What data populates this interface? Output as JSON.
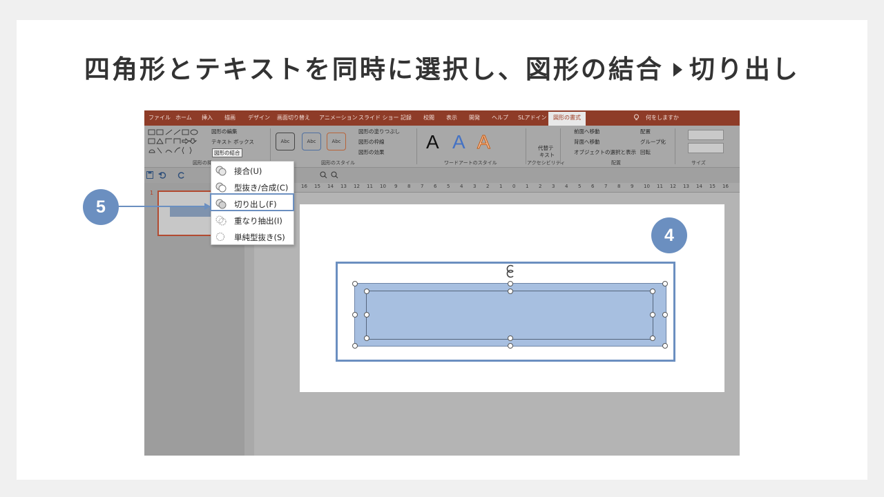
{
  "heading": {
    "before": "四角形とテキストを同時に選択し、図形の結合",
    "after": "切り出し"
  },
  "menubar": {
    "tabs": [
      "ファイル",
      "ホーム",
      "挿入",
      "描画",
      "デザイン",
      "画面切り替え",
      "アニメーション",
      "スライド ショー",
      "記録",
      "校閲",
      "表示",
      "開発",
      "ヘルプ",
      "SLアドイン"
    ],
    "active_tab": "図形の書式",
    "tell_me": "何をしますか"
  },
  "ribbon": {
    "edit_shape": "図形の編集",
    "text_box": "テキスト ボックス",
    "merge_shapes": "図形の結合",
    "insert_group_label": "図形の挿",
    "style_samples": [
      "Abc",
      "Abc",
      "Abc"
    ],
    "shape_fill": "図形の塗りつぶし",
    "shape_outline": "図形の枠線",
    "shape_effects": "図形の効果",
    "shape_styles_group": "図形のスタイル",
    "wordart_letter": "A",
    "wordart_group": "ワードアートのスタイル",
    "alt_text_line1": "代替テ",
    "alt_text_line2": "キスト",
    "accessibility_group": "アクセシビリティ",
    "bring_forward": "前面へ移動",
    "send_backward": "背面へ移動",
    "selection_pane": "オブジェクトの選択と表示",
    "align": "配置",
    "group": "グループ化",
    "rotate": "回転",
    "arrange_group": "配置",
    "size_group": "サイズ"
  },
  "ruler": {
    "marks": [
      "16",
      "15",
      "14",
      "13",
      "12",
      "11",
      "10",
      "9",
      "8",
      "7",
      "6",
      "5",
      "4",
      "3",
      "2",
      "1",
      "0",
      "1",
      "2",
      "3",
      "4",
      "5",
      "6",
      "7",
      "8",
      "9",
      "10",
      "11",
      "12",
      "13",
      "14",
      "15",
      "16"
    ]
  },
  "thumbnail": {
    "number": "1"
  },
  "merge_menu": {
    "items": [
      {
        "label": "接合(U)"
      },
      {
        "label": "型抜き/合成(C)"
      },
      {
        "label": "切り出し(F)"
      },
      {
        "label": "重なり抽出(I)"
      },
      {
        "label": "単純型抜き(S)"
      }
    ]
  },
  "callouts": {
    "step_a": "4",
    "step_b": "5"
  },
  "colors": {
    "accent": "#6b8fc0",
    "ribbon_red": "#8e3c28",
    "shape_fill": "#a7bfe0",
    "heading": "#333333"
  }
}
